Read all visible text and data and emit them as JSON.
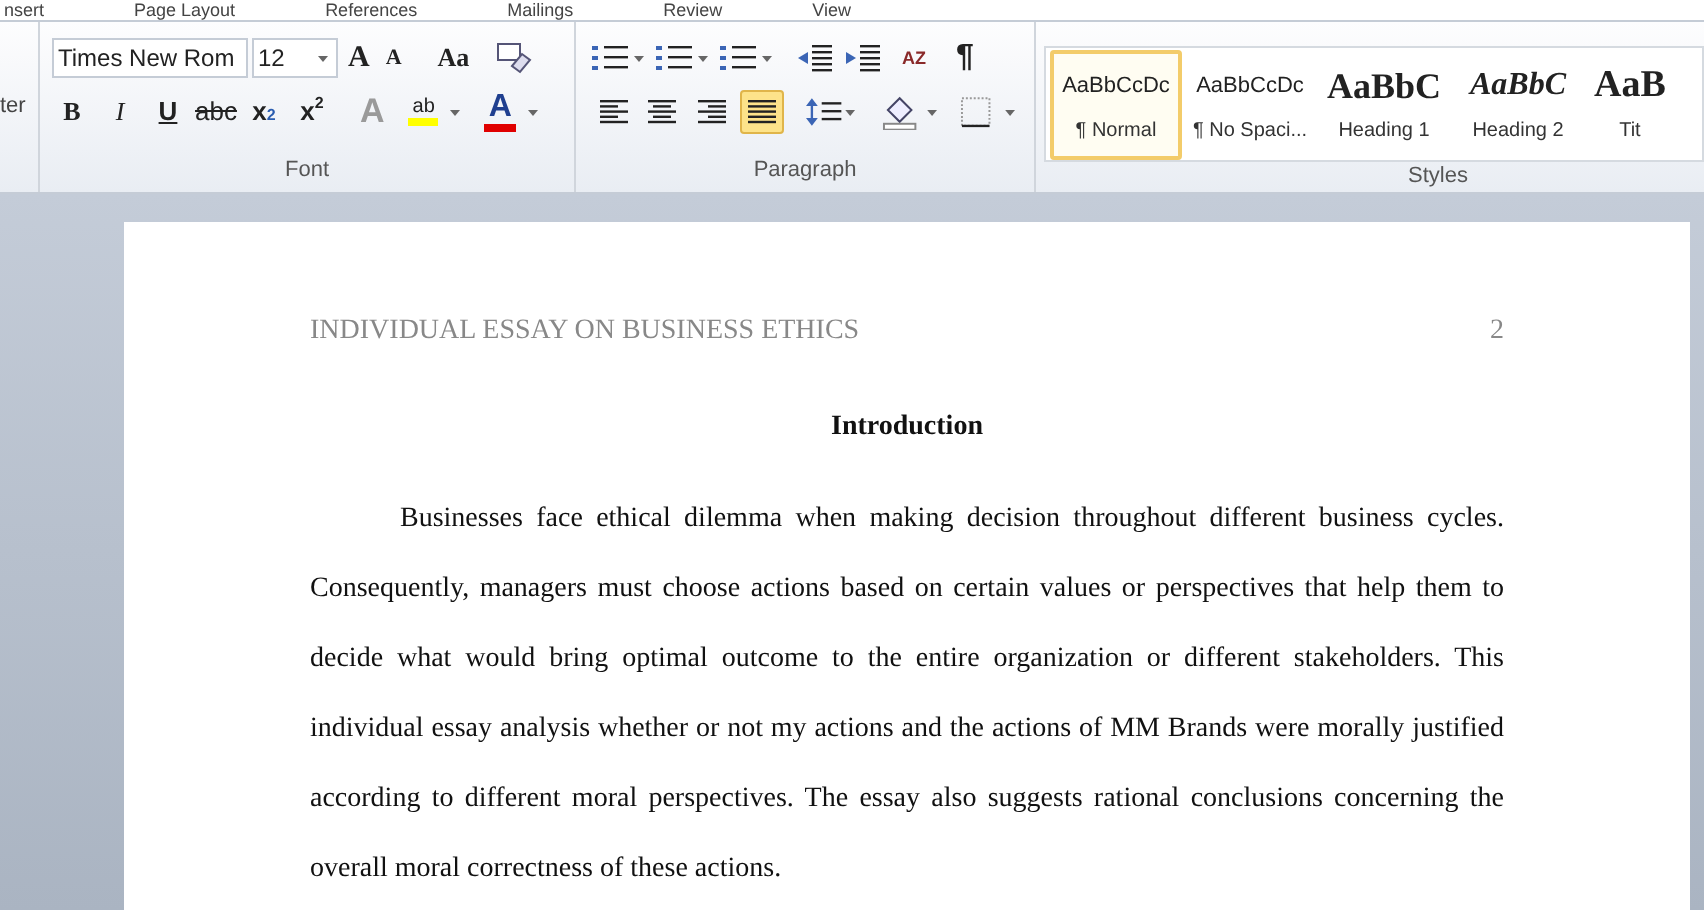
{
  "ribbon_tabs": [
    "nsert",
    "Page Layout",
    "References",
    "Mailings",
    "Review",
    "View"
  ],
  "clipboard": {
    "label_fragment": "ter"
  },
  "font": {
    "font_name": "Times New Rom",
    "font_size": "12",
    "grow_label": "A",
    "shrink_label": "A",
    "case_label": "Aa",
    "format_buttons": [
      {
        "kind": "bold",
        "label": "B"
      },
      {
        "kind": "italic",
        "label": "I"
      },
      {
        "kind": "underline",
        "label": "U"
      },
      {
        "kind": "strike",
        "label": "abc"
      },
      {
        "kind": "sub",
        "label": "x",
        "index": "2"
      },
      {
        "kind": "sup",
        "label": "x",
        "index": "2"
      }
    ],
    "effects_label": "A",
    "highlight_label": "ab",
    "color_label": "A",
    "group_label": "Font"
  },
  "paragraph": {
    "alignments": [
      {
        "kind": "left",
        "selected": false
      },
      {
        "kind": "center",
        "selected": false
      },
      {
        "kind": "right",
        "selected": false
      },
      {
        "kind": "justify",
        "selected": true
      }
    ],
    "pilcrow": "¶",
    "sort_label": "AZ",
    "group_label": "Paragraph"
  },
  "styles": {
    "items": [
      {
        "kind": "normal",
        "preview": "AaBbCcDc",
        "name": "¶ Normal",
        "selected": true
      },
      {
        "kind": "normal",
        "preview": "AaBbCcDc",
        "name": "¶ No Spaci...",
        "selected": false
      },
      {
        "kind": "heading1",
        "preview": "AaBbC",
        "name": "Heading 1",
        "selected": false
      },
      {
        "kind": "heading2",
        "preview": "AaBbC",
        "name": "Heading 2",
        "selected": false
      },
      {
        "kind": "title",
        "preview": "AaB",
        "name": "Tit",
        "selected": false
      }
    ],
    "group_label": "Styles"
  },
  "document": {
    "header": "INDIVIDUAL ESSAY ON BUSINESS ETHICS",
    "page_number": "2",
    "heading": "Introduction",
    "paragraph": "Businesses face ethical dilemma when making decision throughout different business cycles. Consequently, managers must choose actions based on certain values or perspectives that help them to decide what would bring optimal outcome to the entire organization or different stakeholders. This individual essay analysis whether or not my actions and the actions of MM Brands were morally justified according to different moral perspectives. The essay also suggests rational conclusions concerning the overall moral correctness of these actions."
  }
}
